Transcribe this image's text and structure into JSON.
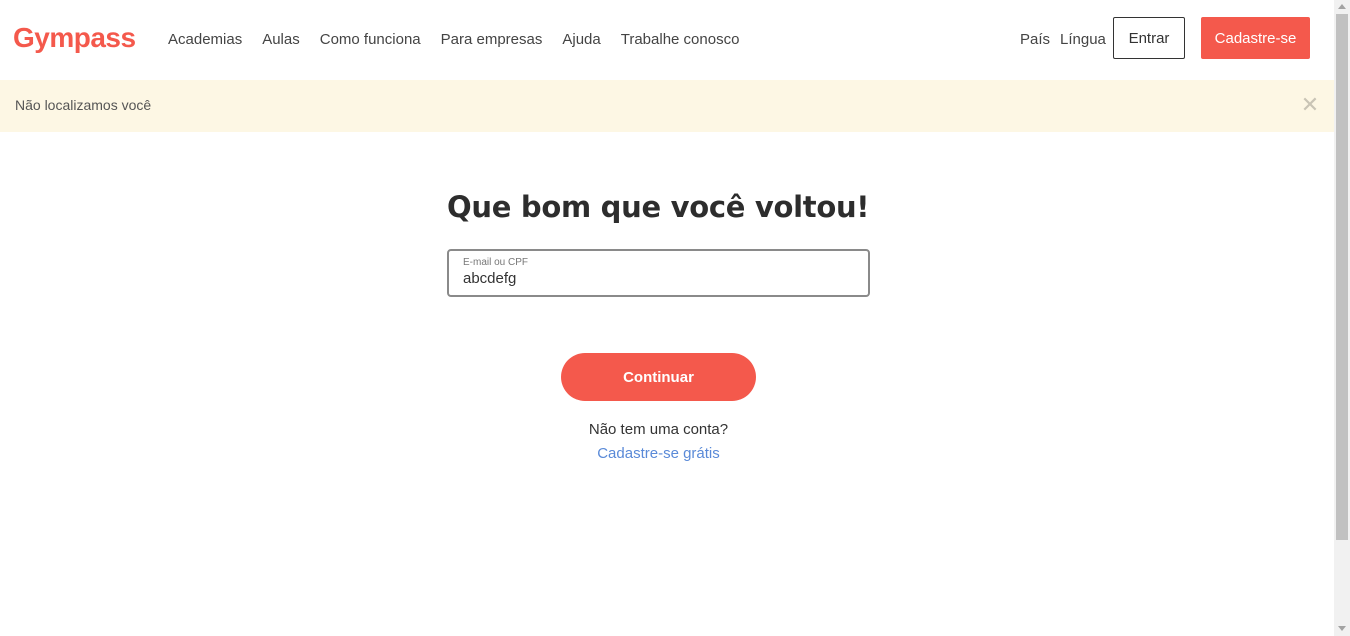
{
  "header": {
    "logo": "Gympass",
    "nav": [
      "Academias",
      "Aulas",
      "Como funciona",
      "Para empresas",
      "Ajuda",
      "Trabalhe conosco"
    ],
    "country_label": "País",
    "language_label": "Língua",
    "login_label": "Entrar",
    "signup_label": "Cadastre-se"
  },
  "notice": {
    "text": "Não localizamos você",
    "close_icon": "close-icon"
  },
  "main": {
    "title": "Que bom que você voltou!",
    "field_label": "E-mail ou CPF",
    "field_value": "abcdefg",
    "continue_label": "Continuar",
    "no_account_text": "Não tem uma conta?",
    "signup_link": "Cadastre-se grátis"
  },
  "colors": {
    "brand": "#f4594c",
    "notice_bg": "#fdf7e4",
    "link": "#5a8ad8"
  }
}
